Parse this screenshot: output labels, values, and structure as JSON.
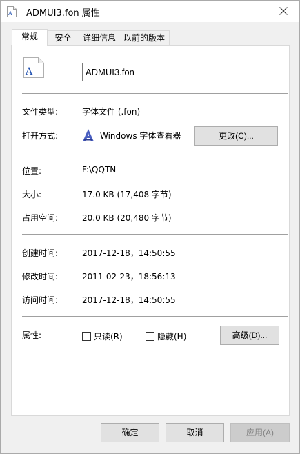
{
  "window": {
    "title": "ADMUI3.fon 属性"
  },
  "tabs": [
    {
      "label": "常规",
      "active": true
    },
    {
      "label": "安全",
      "active": false
    },
    {
      "label": "详细信息",
      "active": false
    },
    {
      "label": "以前的版本",
      "active": false
    }
  ],
  "general": {
    "filename": "ADMUI3.fon",
    "type_label": "文件类型:",
    "type_value": "字体文件 (.fon)",
    "opens_with_label": "打开方式:",
    "opens_with_value": "Windows 字体查看器",
    "change_button": "更改(C)...",
    "location_label": "位置:",
    "location_value": "F:\\QQTN",
    "size_label": "大小:",
    "size_value": "17.0 KB (17,408 字节)",
    "size_on_disk_label": "占用空间:",
    "size_on_disk_value": "20.0 KB (20,480 字节)",
    "created_label": "创建时间:",
    "created_value": "2017-12-18，14:50:55",
    "modified_label": "修改时间:",
    "modified_value": "2011-02-23，18:56:13",
    "accessed_label": "访问时间:",
    "accessed_value": "2017-12-18，14:50:55",
    "attributes_label": "属性:",
    "readonly_label": "只读(R)",
    "readonly_checked": false,
    "hidden_label": "隐藏(H)",
    "hidden_checked": false,
    "advanced_button": "高级(D)..."
  },
  "footer": {
    "ok": "确定",
    "cancel": "取消",
    "apply": "应用(A)"
  },
  "icons": {
    "title": "font-file-icon",
    "file": "font-file-icon",
    "app": "font-viewer-icon",
    "close": "close-icon"
  }
}
